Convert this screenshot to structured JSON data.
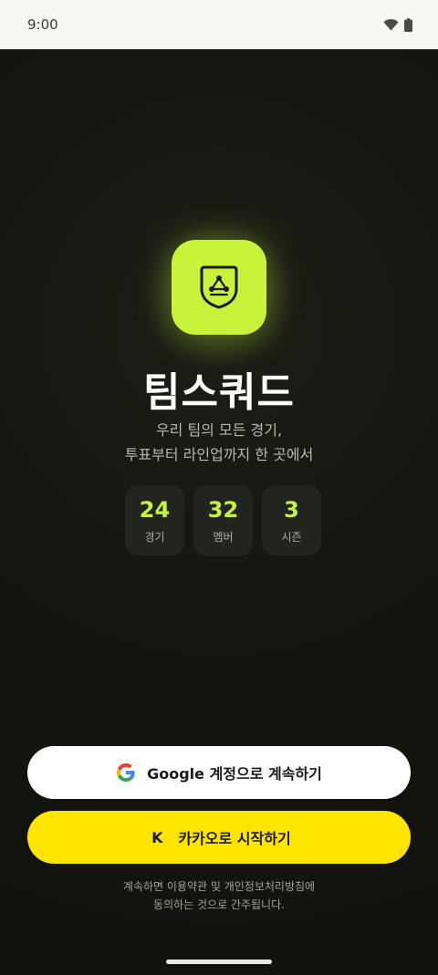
{
  "status_bar": {
    "time": "9:00",
    "wifi_icon": "wifi-icon",
    "battery_icon": "battery-icon"
  },
  "app": {
    "logo_icon": "shield-network-icon",
    "title": "팀스쿼드",
    "tagline_line1": "우리 팀의 모든 경기,",
    "tagline_line2": "투표부터 라인업까지 한 곳에서"
  },
  "stats": [
    {
      "value": "24",
      "label": "경기"
    },
    {
      "value": "32",
      "label": "멤버"
    },
    {
      "value": "3",
      "label": "시즌"
    }
  ],
  "buttons": {
    "google_label": "Google 계정으로 계속하기",
    "google_icon": "google-g-icon",
    "kakao_mark": "K",
    "kakao_label": "카카오로 시작하기"
  },
  "terms": {
    "line1": "계속하면 이용약관 및 개인정보처리방침에",
    "line2": "동의하는 것으로 간주됩니다."
  },
  "colors": {
    "accent": "#c9f23b",
    "kakao": "#fde500",
    "background": "#121210"
  }
}
